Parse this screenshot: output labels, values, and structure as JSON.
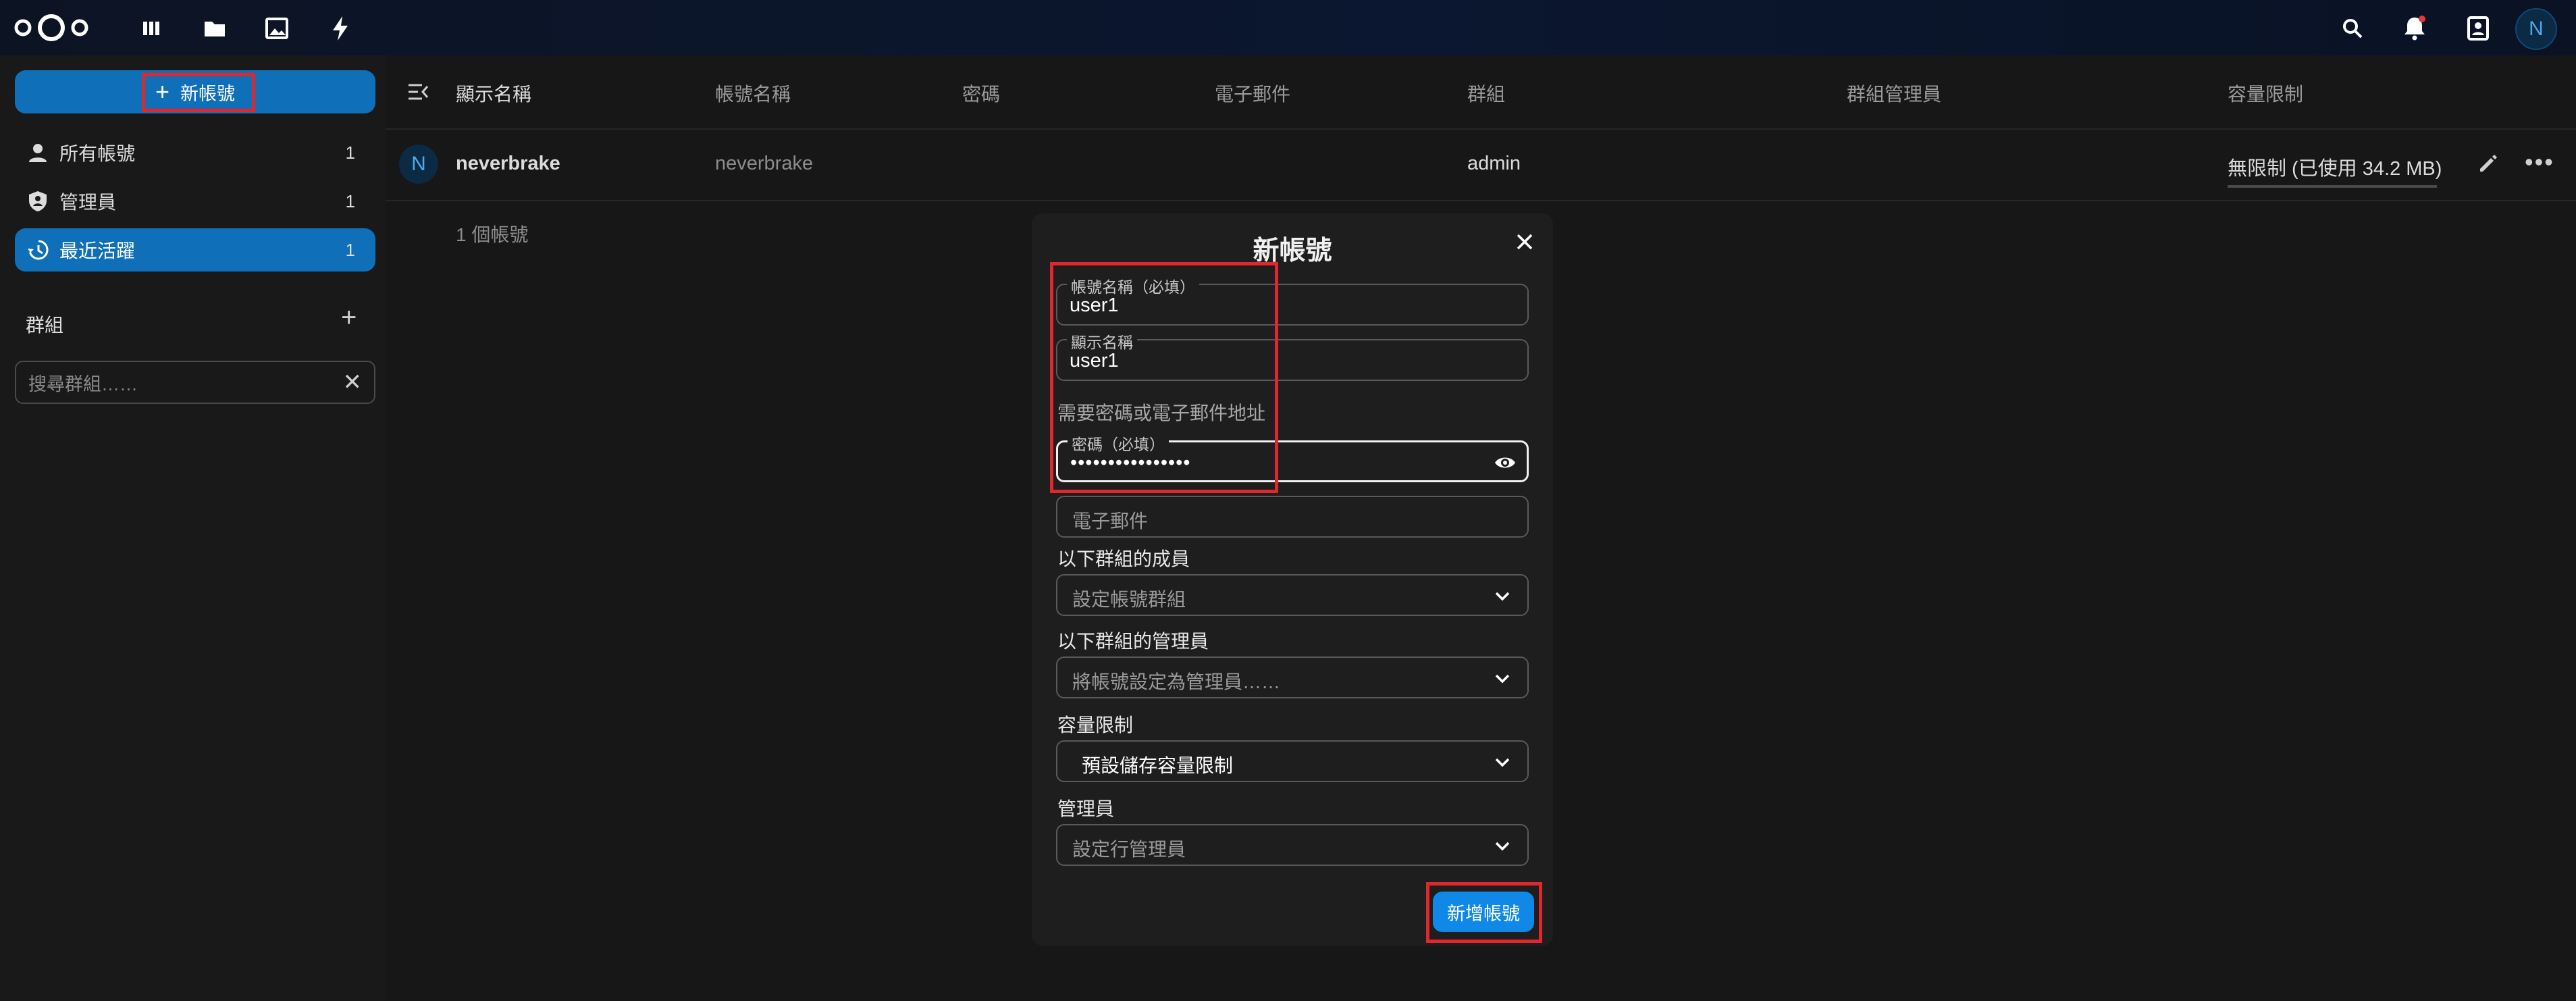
{
  "topbar": {
    "apps": [
      {
        "name": "dashboard-icon"
      },
      {
        "name": "files-icon"
      },
      {
        "name": "photos-icon"
      },
      {
        "name": "activity-icon"
      }
    ],
    "right": [
      {
        "name": "search-icon"
      },
      {
        "name": "notifications-icon"
      },
      {
        "name": "contacts-icon"
      }
    ],
    "avatar_letter": "N"
  },
  "sidebar": {
    "new_account_label": "新帳號",
    "items": [
      {
        "label": "所有帳號",
        "count": "1",
        "icon": "person-icon"
      },
      {
        "label": "管理員",
        "count": "1",
        "icon": "shield-account-icon"
      },
      {
        "label": "最近活躍",
        "count": "1",
        "icon": "history-icon"
      }
    ],
    "groups_title": "群組",
    "group_search_placeholder": "搜尋群組……"
  },
  "table": {
    "headers": [
      "顯示名稱",
      "帳號名稱",
      "密碼",
      "電子郵件",
      "群組",
      "群組管理員",
      "容量限制"
    ],
    "rows": [
      {
        "avatar": "N",
        "display_name": "neverbrake",
        "account_name": "neverbrake",
        "groups": "admin",
        "quota": "無限制 (已使用 34.2 MB)"
      }
    ],
    "footer_count": "1 個帳號"
  },
  "modal": {
    "title": "新帳號",
    "account_name_label": "帳號名稱（必填）",
    "account_name_value": "user1",
    "display_name_label": "顯示名稱",
    "display_name_value": "user1",
    "hint": "需要密碼或電子郵件地址",
    "password_label": "密碼（必填）",
    "password_value": "••••••••••••••••",
    "email_placeholder": "電子郵件",
    "member_groups_label": "以下群組的成員",
    "member_groups_placeholder": "設定帳號群組",
    "admin_groups_label": "以下群組的管理員",
    "admin_groups_placeholder": "將帳號設定為管理員……",
    "quota_label": "容量限制",
    "quota_value": "預設儲存容量限制",
    "manager_label": "管理員",
    "manager_placeholder": "設定行管理員",
    "submit_label": "新增帳號"
  },
  "colors": {
    "accent": "#0f6fb8",
    "submit": "#0f88e8",
    "highlight": "#e3262c",
    "background": "#171717"
  }
}
